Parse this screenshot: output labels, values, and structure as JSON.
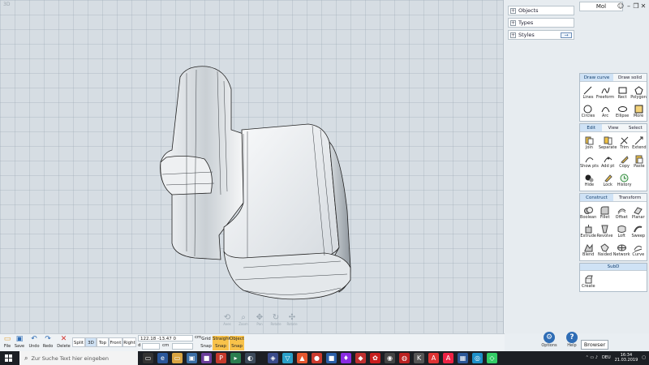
{
  "viewport": {
    "label": "3D",
    "nav_tools": [
      {
        "label": "Axes",
        "glyph": "⟲"
      },
      {
        "label": "Zoom",
        "glyph": "⌕"
      },
      {
        "label": "Pan",
        "glyph": "✥"
      },
      {
        "label": "Rotate",
        "glyph": "↻"
      },
      {
        "label": "Rotate",
        "glyph": "✣"
      }
    ]
  },
  "sidebar": {
    "accordion": [
      {
        "label": "Objects"
      },
      {
        "label": "Types"
      },
      {
        "label": "Styles"
      }
    ],
    "document_title": "Mol",
    "window_controls": [
      "☺",
      "–",
      "❐",
      "✕"
    ],
    "draw_panel": {
      "tabs": [
        "Draw curve",
        "Draw solid"
      ],
      "tools": [
        {
          "label": "Lines",
          "icon": "lines-icon"
        },
        {
          "label": "Freeform",
          "icon": "freeform-icon"
        },
        {
          "label": "Rect",
          "icon": "rect-icon"
        },
        {
          "label": "Polygon",
          "icon": "polygon-icon"
        },
        {
          "label": "Circles",
          "icon": "circle-icon"
        },
        {
          "label": "Arc",
          "icon": "arc-icon"
        },
        {
          "label": "Ellipse",
          "icon": "ellipse-icon"
        },
        {
          "label": "More",
          "icon": "more-icon"
        }
      ]
    },
    "edit_panel": {
      "tabs": [
        "Edit",
        "View",
        "Select"
      ],
      "tools": [
        {
          "label": "Join",
          "icon": "join-icon"
        },
        {
          "label": "Separate",
          "icon": "separate-icon"
        },
        {
          "label": "Trim",
          "icon": "trim-icon"
        },
        {
          "label": "Extend",
          "icon": "extend-icon"
        },
        {
          "label": "Show pts",
          "icon": "show-points-icon"
        },
        {
          "label": "Add pt",
          "icon": "add-point-icon"
        },
        {
          "label": "Copy",
          "icon": "copy-icon"
        },
        {
          "label": "Paste",
          "icon": "paste-icon"
        },
        {
          "label": "Hide",
          "icon": "hide-icon"
        },
        {
          "label": "Lock",
          "icon": "lock-icon"
        },
        {
          "label": "History",
          "icon": "history-icon"
        }
      ]
    },
    "construct_panel": {
      "tabs": [
        "Construct",
        "Transform"
      ],
      "tools": [
        {
          "label": "Boolean",
          "icon": "boolean-icon"
        },
        {
          "label": "Fillet",
          "icon": "fillet-icon"
        },
        {
          "label": "Offset",
          "icon": "offset-icon"
        },
        {
          "label": "Planar",
          "icon": "planar-icon"
        },
        {
          "label": "Extrude",
          "icon": "extrude-icon"
        },
        {
          "label": "Revolve",
          "icon": "revolve-icon"
        },
        {
          "label": "Loft",
          "icon": "loft-icon"
        },
        {
          "label": "Sweep",
          "icon": "sweep-icon"
        },
        {
          "label": "Blend",
          "icon": "blend-icon"
        },
        {
          "label": "Nsided",
          "icon": "nsided-icon"
        },
        {
          "label": "Network",
          "icon": "network-icon"
        },
        {
          "label": "Curve",
          "icon": "curve-icon"
        }
      ]
    },
    "subd_panel": {
      "header": "SubD",
      "tools": [
        {
          "label": "Create",
          "icon": "create-icon"
        }
      ]
    },
    "options_label": "Options",
    "help_label": "Help",
    "browser_label": "Browser"
  },
  "toolbar": {
    "file_buttons": [
      {
        "label": "File",
        "icon": "folder-icon",
        "glyph": "▭",
        "color": "#e2a33a"
      },
      {
        "label": "Save",
        "icon": "save-icon",
        "glyph": "▣",
        "color": "#2f6db5"
      },
      {
        "label": "Undo",
        "icon": "undo-icon",
        "glyph": "↶",
        "color": "#2f6db5"
      },
      {
        "label": "Redo",
        "icon": "redo-icon",
        "glyph": "↷",
        "color": "#2f6db5"
      },
      {
        "label": "Delete",
        "icon": "delete-icon",
        "glyph": "✕",
        "color": "#d2302c"
      }
    ],
    "views": [
      "Split",
      "3D",
      "Top",
      "Front",
      "Right"
    ],
    "active_view": "3D",
    "coord_value": "122.18    -13.47    0",
    "coord_unit": "cm",
    "distance_prefix": "d",
    "distance_unit": "cm",
    "grid_snap": [
      "Grid",
      "Snap"
    ],
    "straight_snap": [
      "Straight",
      "Snap"
    ],
    "object_snap": [
      "Object",
      "Snap"
    ]
  },
  "taskbar": {
    "search_placeholder": "Zur Suche Text hier eingeben",
    "language": "DEU",
    "time": "16:34",
    "date": "21.03.2019"
  },
  "colors": {
    "accent": "#cfe2f5",
    "snap_active": "#f8c24a",
    "options_icon": "#2f6db5",
    "help_icon": "#2f6db5"
  }
}
